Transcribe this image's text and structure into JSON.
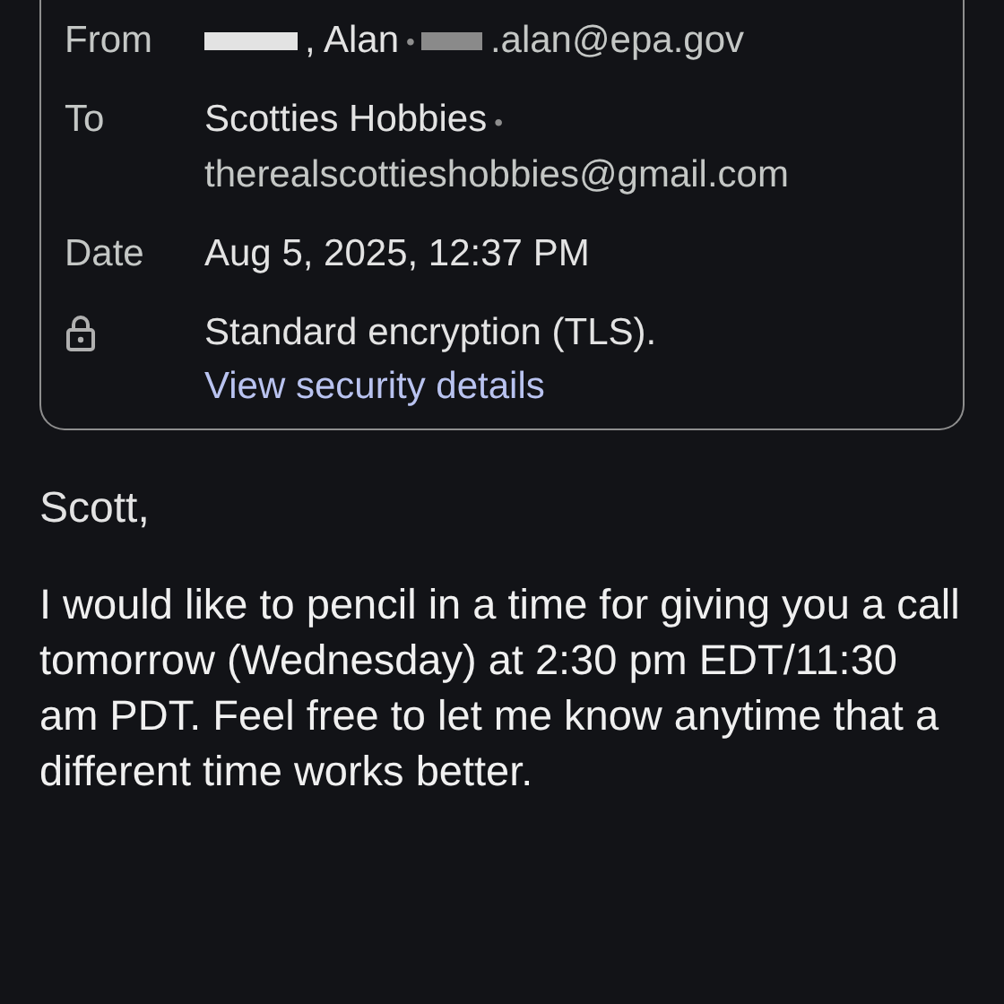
{
  "details": {
    "rows": [
      {
        "kind": "from",
        "label": "From",
        "name": ", Alan",
        "separator": "•",
        "email": ".alan@epa.gov"
      },
      {
        "kind": "to",
        "label": "To",
        "name": "Scotties Hobbies",
        "separator": "•",
        "email": "therealscottieshobbies@gmail.com"
      },
      {
        "kind": "date",
        "label": "Date",
        "value": "Aug 5, 2025, 12:37 PM"
      },
      {
        "kind": "security",
        "value": "Standard encryption (TLS).",
        "link": "View security details"
      }
    ]
  },
  "body": {
    "greeting": "Scott,",
    "paragraph": "I would like to pencil in a time for giving you a call tomorrow (Wednesday) at 2:30 pm EDT/11:30 am PDT. Feel free to let me know anytime that a different time works better."
  }
}
